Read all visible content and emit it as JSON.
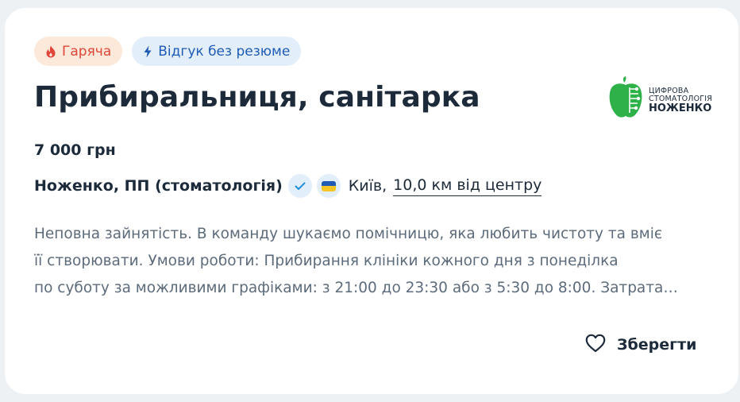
{
  "tags": {
    "hot_label": "Гаряча",
    "fast_label": "Відгук без резюме"
  },
  "job": {
    "title": "Прибиральниця, санітарка",
    "salary": "7 000 грн",
    "company": "Ноженко, ПП (стоматологія)",
    "city": "Київ,",
    "distance": "10,0 км від центру",
    "description_lines": [
      "Неповна зайнятість. В команду шукаємо помічницю, яка любить чистоту та вміє",
      "її створювати. Умови роботи: Прибирання клініки кожного дня з понеділка",
      "по суботу за можливими графіками: з 21:00 до 23:30 або з 5:30 до 8:00. Затрата…"
    ]
  },
  "logo": {
    "line1": "ЦИФРОВА",
    "line2": "СТОМАТОЛОГІЯ",
    "line3": "НОЖЕНКО"
  },
  "actions": {
    "save_label": "Зберегти"
  },
  "colors": {
    "hot_bg": "#fde9d9",
    "hot_fg": "#e0463a",
    "fast_bg": "#e3eefb",
    "fast_fg": "#1f5bb5",
    "title": "#1c2a3a",
    "description": "#5d6b7b",
    "logo_green": "#2fb14a"
  },
  "icons": {
    "hot": "flame-icon",
    "fast": "lightning-icon",
    "verified": "check-badge-icon",
    "flag": "ukraine-flag-icon",
    "save": "heart-outline-icon"
  }
}
